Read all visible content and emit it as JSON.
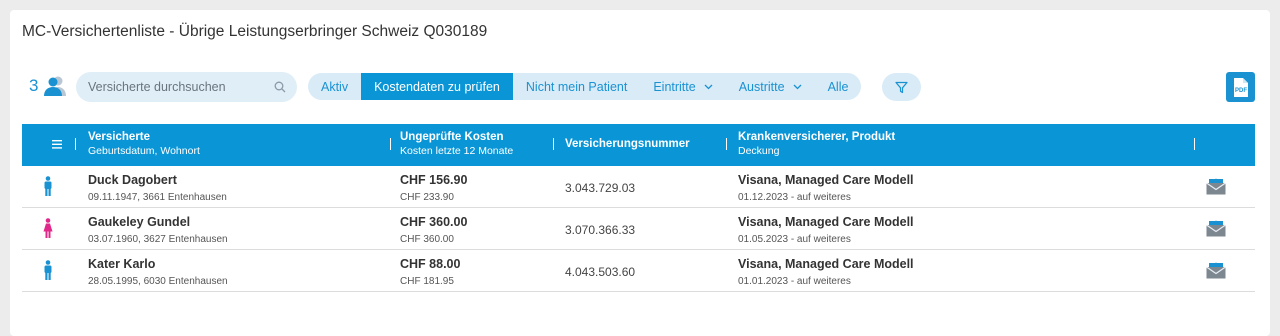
{
  "page": {
    "title": "MC-Versichertenliste - Übrige Leistungserbringer Schweiz Q030189"
  },
  "toolbar": {
    "count": "3",
    "search_placeholder": "Versicherte durchsuchen",
    "filters": [
      {
        "label": "Aktiv",
        "active": false,
        "dropdown": false
      },
      {
        "label": "Kostendaten zu prüfen",
        "active": true,
        "dropdown": false
      },
      {
        "label": "Nicht mein Patient",
        "active": false,
        "dropdown": false
      },
      {
        "label": "Eintritte",
        "active": false,
        "dropdown": true
      },
      {
        "label": "Austritte",
        "active": false,
        "dropdown": true
      },
      {
        "label": "Alle",
        "active": false,
        "dropdown": false
      }
    ],
    "pdf_label": "PDF"
  },
  "table": {
    "headers": {
      "insured_main": "Versicherte",
      "insured_sub": "Geburtsdatum, Wohnort",
      "costs_main": "Ungeprüfte Kosten",
      "costs_sub": "Kosten letzte 12 Monate",
      "number_main": "Versicherungsnummer",
      "insurer_main": "Krankenversicherer, Produkt",
      "insurer_sub": "Deckung"
    },
    "rows": [
      {
        "gender": "male",
        "name": "Duck Dagobert",
        "birth_place": "09.11.1947, 3661 Entenhausen",
        "unchecked_cost": "CHF 156.90",
        "cost_12m": "CHF 233.90",
        "insurance_number": "3.043.729.03",
        "insurer": "Visana, Managed Care Modell",
        "coverage": "01.12.2023 - auf weiteres"
      },
      {
        "gender": "female",
        "name": "Gaukeley Gundel",
        "birth_place": "03.07.1960, 3627 Entenhausen",
        "unchecked_cost": "CHF 360.00",
        "cost_12m": "CHF 360.00",
        "insurance_number": "3.070.366.33",
        "insurer": "Visana, Managed Care Modell",
        "coverage": "01.05.2023 - auf weiteres"
      },
      {
        "gender": "male",
        "name": "Kater Karlo",
        "birth_place": "28.05.1995, 6030 Entenhausen",
        "unchecked_cost": "CHF 88.00",
        "cost_12m": "CHF 181.95",
        "insurance_number": "4.043.503.60",
        "insurer": "Visana, Managed Care Modell",
        "coverage": "01.01.2023 - auf weiteres"
      }
    ]
  },
  "colors": {
    "accent": "#0a96d6",
    "male": "#1a92d2",
    "female": "#e0288a"
  },
  "icons": {
    "users": "users-icon",
    "search": "search-icon",
    "filter": "filter-icon",
    "pdf": "pdf-icon",
    "menu": "menu-icon",
    "envelope": "envelope-icon"
  }
}
